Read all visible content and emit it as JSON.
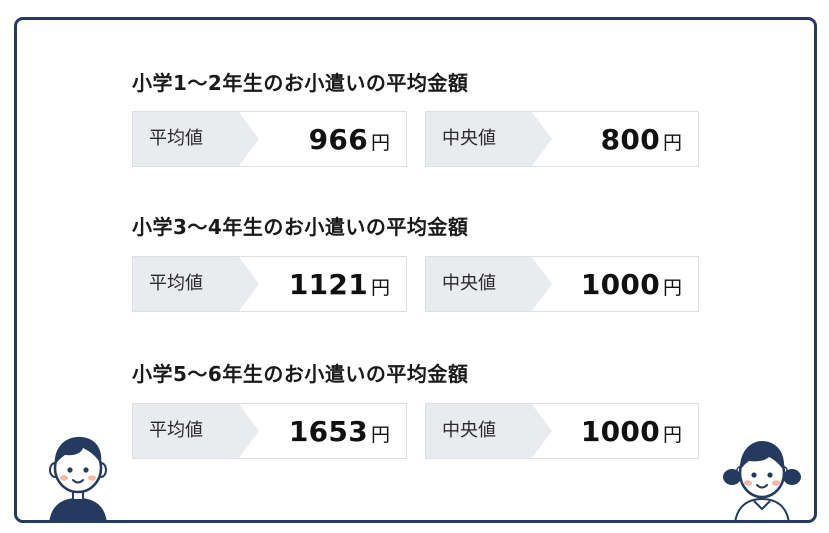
{
  "groups": [
    {
      "title": "小学1〜2年生のお小遣いの平均金額",
      "average": {
        "label": "平均値",
        "value": "966",
        "unit": "円"
      },
      "median": {
        "label": "中央値",
        "value": "800",
        "unit": "円"
      }
    },
    {
      "title": "小学3〜4年生のお小遣いの平均金額",
      "average": {
        "label": "平均値",
        "value": "1121",
        "unit": "円"
      },
      "median": {
        "label": "中央値",
        "value": "1000",
        "unit": "円"
      }
    },
    {
      "title": "小学5〜6年生のお小遣いの平均金額",
      "average": {
        "label": "平均値",
        "value": "1653",
        "unit": "円"
      },
      "median": {
        "label": "中央値",
        "value": "1000",
        "unit": "円"
      }
    }
  ],
  "colors": {
    "frame_border": "#253a5e",
    "tag_background": "#e9ebef",
    "box_border": "#dcdfe4",
    "cheek": "#f6b8a6"
  },
  "icons": {
    "left_character": "boy-avatar-icon",
    "right_character": "girl-avatar-icon"
  }
}
